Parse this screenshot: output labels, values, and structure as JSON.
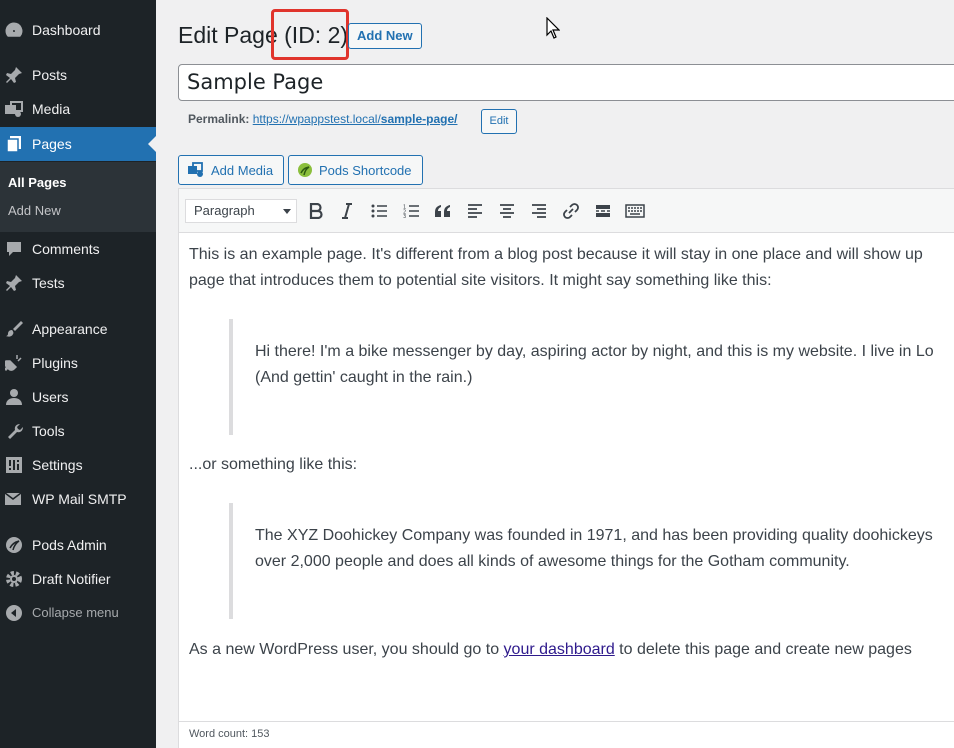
{
  "sidebar": {
    "items": [
      {
        "label": "Dashboard",
        "icon": "dashboard-icon"
      },
      {
        "label": "Posts",
        "icon": "pin-icon"
      },
      {
        "label": "Media",
        "icon": "media-icon"
      },
      {
        "label": "Pages",
        "icon": "pages-icon",
        "active": true
      },
      {
        "label": "Comments",
        "icon": "comments-icon"
      },
      {
        "label": "Tests",
        "icon": "pin-icon"
      },
      {
        "label": "Appearance",
        "icon": "brush-icon"
      },
      {
        "label": "Plugins",
        "icon": "plug-icon"
      },
      {
        "label": "Users",
        "icon": "user-icon"
      },
      {
        "label": "Tools",
        "icon": "wrench-icon"
      },
      {
        "label": "Settings",
        "icon": "settings-icon"
      },
      {
        "label": "WP Mail SMTP",
        "icon": "mail-icon"
      },
      {
        "label": "Pods Admin",
        "icon": "pods-icon"
      },
      {
        "label": "Draft Notifier",
        "icon": "gear-icon"
      },
      {
        "label": "Collapse menu",
        "icon": "collapse-icon"
      }
    ],
    "submenu": [
      {
        "label": "All Pages",
        "current": true
      },
      {
        "label": "Add New"
      }
    ]
  },
  "header": {
    "title_prefix": "Edit Page",
    "title_id": "(ID: 2)",
    "add_new_label": "Add New"
  },
  "post": {
    "title": "Sample Page",
    "permalink_label": "Permalink:",
    "permalink_base": "https://wpappstest.local/",
    "permalink_slug": "sample-page/",
    "permalink_edit": "Edit"
  },
  "media_buttons": {
    "add_media": "Add Media",
    "pods_shortcode": "Pods Shortcode"
  },
  "toolbar": {
    "format_select": "Paragraph",
    "buttons": [
      "bold",
      "italic",
      "bullet-list",
      "numbered-list",
      "blockquote",
      "align-left",
      "align-center",
      "align-right",
      "link",
      "read-more",
      "toolbar-toggle"
    ]
  },
  "content": {
    "p1_line1": "This is an example page. It's different from a blog post because it will stay in one place and will show up",
    "p1_line2": "page that introduces them to potential site visitors. It might say something like this:",
    "q1_line1": "Hi there! I'm a bike messenger by day, aspiring actor by night, and this is my website. I live in Lo",
    "q1_line2": "(And gettin' caught in the rain.)",
    "p2": "...or something like this:",
    "q2_line1": "The XYZ Doohickey Company was founded in 1971, and has been providing quality doohickeys",
    "q2_line2": "over 2,000 people and does all kinds of awesome things for the Gotham community.",
    "p3_before": "As a new WordPress user, you should go to ",
    "p3_link": "your dashboard",
    "p3_after": " to delete this page and create new pages"
  },
  "status": {
    "word_count": "Word count: 153"
  },
  "colors": {
    "sidebar_bg": "#1d2327",
    "accent": "#2271b1",
    "highlight": "#e0342c"
  }
}
